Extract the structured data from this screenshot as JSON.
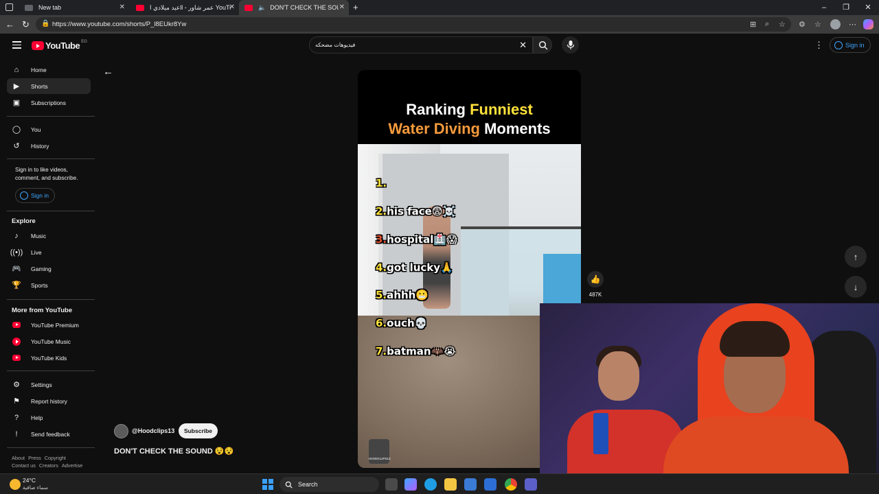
{
  "browser": {
    "tabs": [
      {
        "title": "New tab"
      },
      {
        "title": "عيد ميلادي اll - عمر شاور YouTube"
      },
      {
        "title": "DON'T CHECK THE SOUND"
      }
    ],
    "url": "https://www.youtube.com/shorts/P_l8EUkr8Yw"
  },
  "header": {
    "logo_text": "YouTube",
    "country_code": "EG",
    "search_value": "فيديوهات مضحكه",
    "sign_in": "Sign in"
  },
  "sidebar": {
    "main": [
      {
        "label": "Home",
        "icon": "home-icon"
      },
      {
        "label": "Shorts",
        "icon": "shorts-icon"
      },
      {
        "label": "Subscriptions",
        "icon": "subscriptions-icon"
      }
    ],
    "you": [
      {
        "label": "You",
        "icon": "you-icon"
      },
      {
        "label": "History",
        "icon": "history-icon"
      }
    ],
    "signin_note": "Sign in to like videos, comment, and subscribe.",
    "signin_label": "Sign in",
    "explore_title": "Explore",
    "explore": [
      {
        "label": "Music",
        "icon": "music-icon"
      },
      {
        "label": "Live",
        "icon": "live-icon"
      },
      {
        "label": "Gaming",
        "icon": "gaming-icon"
      },
      {
        "label": "Sports",
        "icon": "sports-icon"
      }
    ],
    "more_title": "More from YouTube",
    "more": [
      {
        "label": "YouTube Premium"
      },
      {
        "label": "YouTube Music"
      },
      {
        "label": "YouTube Kids"
      }
    ],
    "settings": [
      {
        "label": "Settings",
        "icon": "gear-icon"
      },
      {
        "label": "Report history",
        "icon": "flag-icon"
      },
      {
        "label": "Help",
        "icon": "help-icon"
      },
      {
        "label": "Send feedback",
        "icon": "feedback-icon"
      }
    ],
    "footer_row1": [
      "About",
      "Press",
      "Copyright"
    ],
    "footer_row2": [
      "Contact us",
      "Creators",
      "Advertise"
    ]
  },
  "video": {
    "title_line1_a": "Ranking ",
    "title_line1_b": "Funniest",
    "title_line2_a": "Water Diving",
    "title_line2_b": " Moments",
    "rankings": [
      {
        "num": "1.",
        "text": ""
      },
      {
        "num": "2.",
        "text": "his face😨☠️"
      },
      {
        "num": "3.",
        "text": "hospital🏥😱"
      },
      {
        "num": "4.",
        "text": "got lucky🙏"
      },
      {
        "num": "5.",
        "text": "ahhh😬"
      },
      {
        "num": "6.",
        "text": "ouch💀"
      },
      {
        "num": "7.",
        "text": "batman🦇😭"
      }
    ],
    "watermark": "HOODCLIPS13",
    "like_count": "487K",
    "channel": "@Hoodclips13",
    "subscribe_label": "Subscribe",
    "title": "DON'T CHECK THE SOUND 😵😵"
  },
  "taskbar": {
    "temperature": "24°C",
    "weather": "سماء صافية",
    "search_label": "Search"
  },
  "colors": {
    "youtube_red": "#ff0033",
    "link_blue": "#3ea6ff",
    "title_yellow": "#ffe23a",
    "title_orange": "#f59a3c"
  }
}
